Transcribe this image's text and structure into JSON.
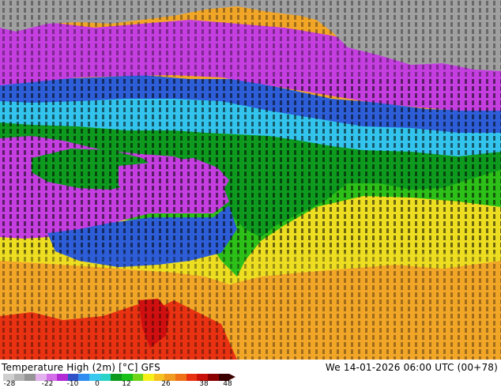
{
  "map": {
    "title": "Temperature High (2m) [°C] GFS",
    "valid_time": "We 14-01-2026 06:00 UTC (00+78)",
    "legend": {
      "tick_labels": [
        "-28",
        "-22",
        "-10",
        "0",
        "12",
        "26",
        "38",
        "48"
      ],
      "colors": [
        "#cfcfcf",
        "#b3b3b3",
        "#959595",
        "#e3b2ee",
        "#d46ee8",
        "#b12ad6",
        "#3050c8",
        "#2f8cf0",
        "#39c8f0",
        "#28d4c8",
        "#0e9a1f",
        "#18c018",
        "#6fd41a",
        "#f6f018",
        "#f6c020",
        "#f09a20",
        "#f07018",
        "#e83010",
        "#c81008",
        "#8a0000",
        "#3a0000"
      ]
    },
    "field_colors": {
      "very_cold": "#a0a0a0",
      "cold_magenta": "#c43ee0",
      "blue": "#2d5ed8",
      "cyan": "#33c4ee",
      "green_dark": "#0e9a1f",
      "green_light": "#2cc018",
      "yellow": "#eede22",
      "orange": "#f2a628",
      "red": "#e83212"
    }
  }
}
